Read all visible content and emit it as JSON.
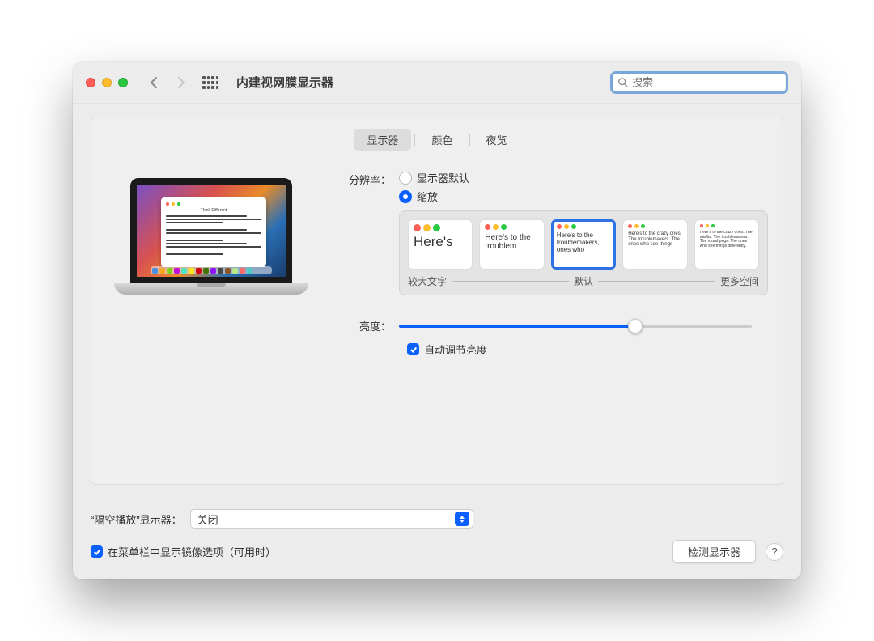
{
  "window": {
    "title": "内建视网膜显示器"
  },
  "search": {
    "placeholder": "搜索"
  },
  "tabs": {
    "display": "显示器",
    "color": "颜色",
    "night": "夜览"
  },
  "resolution": {
    "label": "分辨率：",
    "option_default": "显示器默认",
    "option_scaled": "缩放"
  },
  "scale": {
    "items": [
      {
        "text": "Here's"
      },
      {
        "text": "Here's to the troublem"
      },
      {
        "text": "Here's to the troublemakers, ones who"
      },
      {
        "text": "Here's to the crazy ones. The troublemakers. The ones who see things"
      },
      {
        "text": "Here's to the crazy ones. The misfits. The troublemakers. The round pegs. The ones who see things differently."
      }
    ],
    "label_large": "较大文字",
    "label_default": "默认",
    "label_more": "更多空间",
    "selected_index": 2
  },
  "brightness": {
    "label": "亮度：",
    "auto_label": "自动调节亮度",
    "value_percent": 67
  },
  "airplay": {
    "label": "“隔空播放”显示器：",
    "value": "关闭"
  },
  "menubar": {
    "label": "在菜单栏中显示镜像选项（可用时）"
  },
  "buttons": {
    "detect": "检测显示器"
  }
}
